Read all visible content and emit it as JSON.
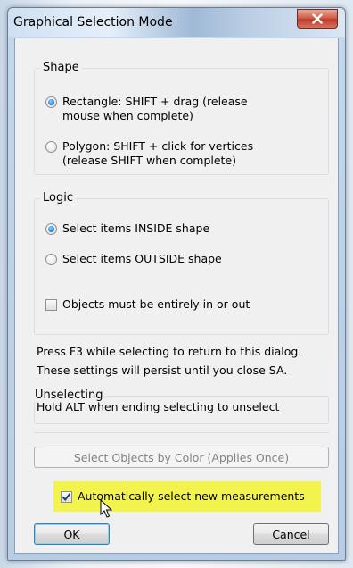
{
  "window": {
    "title": "Graphical Selection Mode"
  },
  "shape": {
    "legend": "Shape",
    "options": [
      {
        "line1": "Rectangle:  SHIFT + drag (release",
        "line2": "mouse when complete)",
        "checked": true
      },
      {
        "line1": "Polygon: SHIFT + click for vertices",
        "line2": "(release SHIFT when complete)",
        "checked": false
      }
    ]
  },
  "logic": {
    "legend": "Logic",
    "options": [
      {
        "label": "Select items INSIDE shape",
        "checked": true
      },
      {
        "label": "Select items OUTSIDE shape",
        "checked": false
      }
    ],
    "entire_checkbox": {
      "label": "Objects must be entirely in or out",
      "checked": false
    }
  },
  "notes": {
    "line1": "Press F3 while selecting to return to this dialog.",
    "line2": "These settings will persist until you close SA."
  },
  "unselecting": {
    "legend": "Unselecting",
    "text": "Hold ALT when ending selecting to unselect"
  },
  "color_button": {
    "label": "Select Objects by Color (Applies Once)",
    "enabled": false
  },
  "auto_select": {
    "label": "Automatically select new measurements",
    "checked": true
  },
  "buttons": {
    "ok": "OK",
    "cancel": "Cancel"
  },
  "colors": {
    "highlight": "#f3f34d",
    "radio_accent": "#2a7fd4"
  }
}
